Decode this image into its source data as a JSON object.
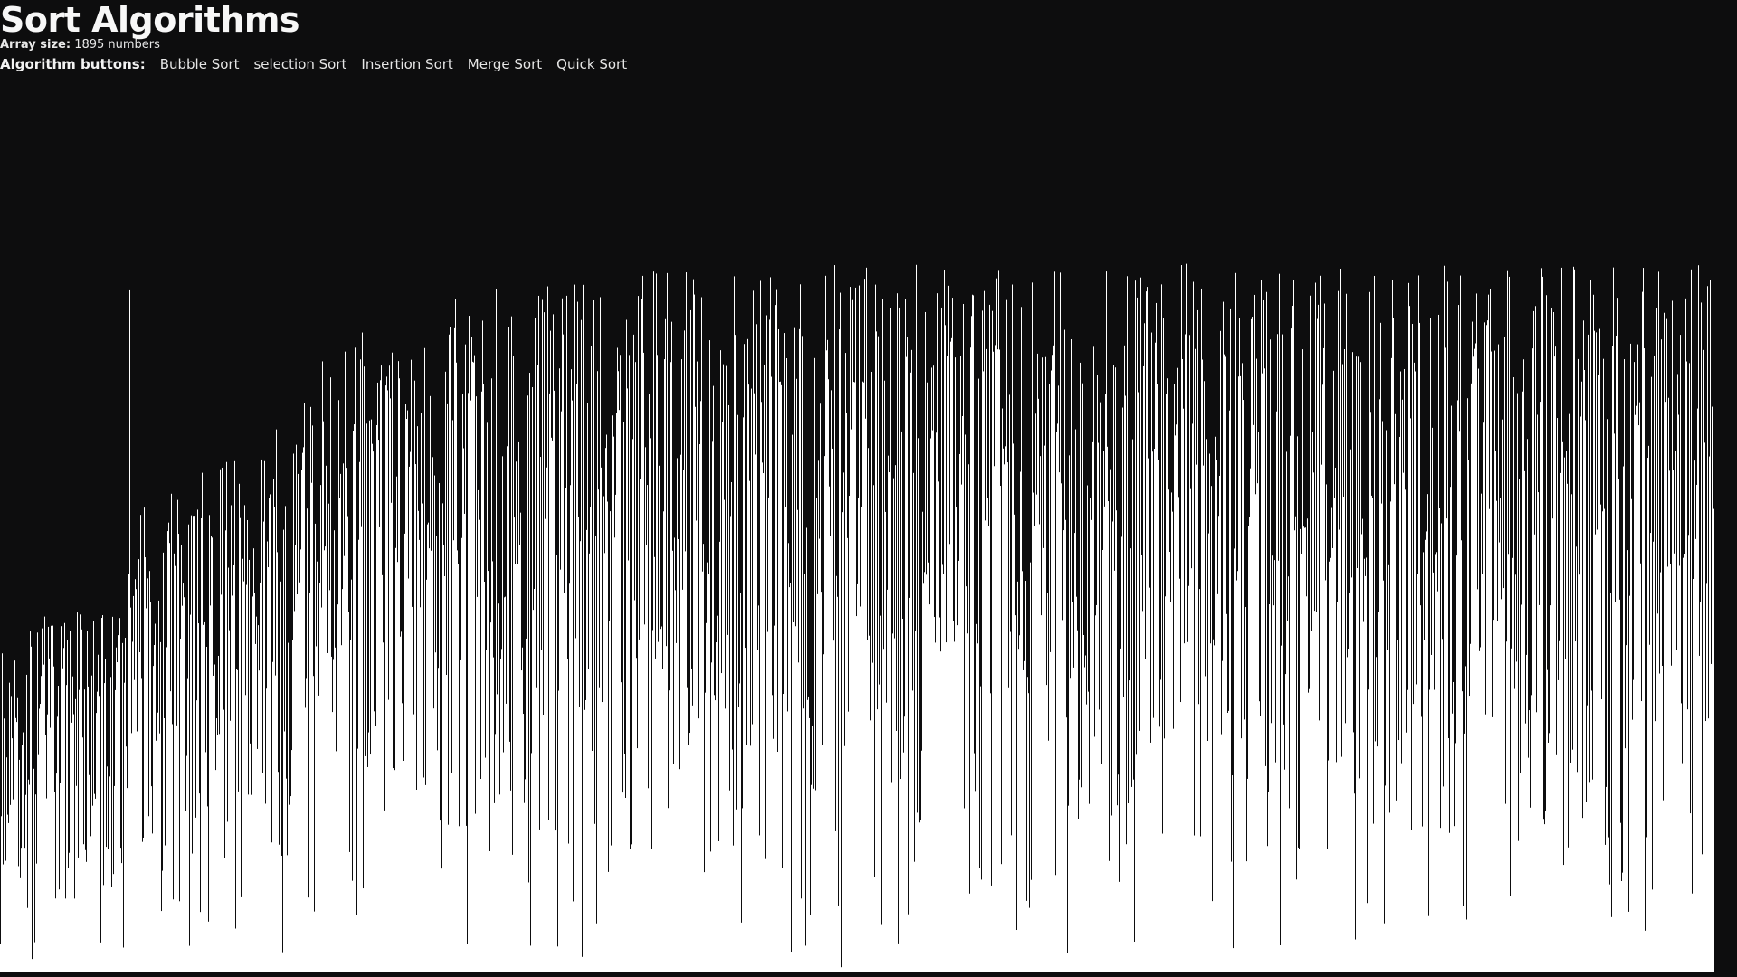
{
  "app": {
    "title": "Sort Algorithms"
  },
  "array_info": {
    "label": "Array size:",
    "value": "1895 numbers"
  },
  "algorithms": {
    "label": "Algorithm buttons:",
    "buttons": [
      {
        "label": "Bubble Sort"
      },
      {
        "label": "selection Sort"
      },
      {
        "label": "Insertion Sort"
      },
      {
        "label": "Merge Sort"
      },
      {
        "label": "Quick Sort"
      }
    ]
  },
  "colors": {
    "background": "#0d0d0e",
    "bar": "#ffffff",
    "text": "#f2f2f2"
  },
  "chart_data": {
    "type": "bar",
    "array_size": 1895,
    "value_range": [
      0,
      1
    ],
    "envelope": [
      {
        "index": 0,
        "max": 0.39
      },
      {
        "index": 130,
        "max": 0.42
      },
      {
        "index": 150,
        "max": 0.52
      },
      {
        "index": 280,
        "max": 0.6
      },
      {
        "index": 380,
        "max": 0.72
      },
      {
        "index": 560,
        "max": 0.78
      },
      {
        "index": 820,
        "max": 0.8
      },
      {
        "index": 1895,
        "max": 0.8
      }
    ],
    "outliers": [
      {
        "index": 143,
        "value": 0.77
      }
    ]
  }
}
